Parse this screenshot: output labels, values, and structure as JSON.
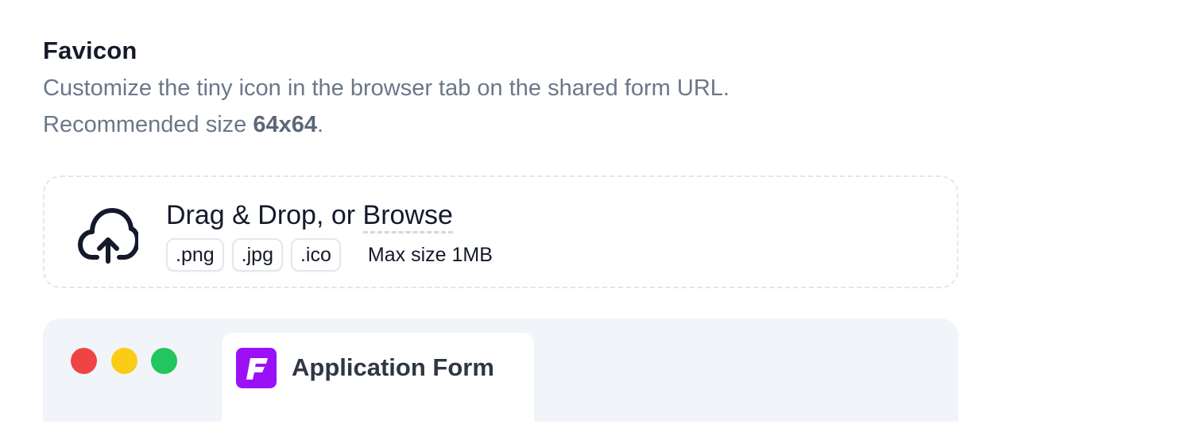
{
  "favicon_section": {
    "title": "Favicon",
    "description_line1": "Customize the tiny icon in the browser tab on the shared form URL.",
    "recommended_prefix": "Recommended size ",
    "recommended_size": "64x64",
    "recommended_suffix": "."
  },
  "dropzone": {
    "icon": "cloud-upload-icon",
    "main_text": "Drag & Drop, or ",
    "browse_label": "Browse",
    "formats": [
      ".png",
      ".jpg",
      ".ico"
    ],
    "max_size": "Max size 1MB"
  },
  "preview": {
    "window_controls": [
      "close",
      "minimize",
      "maximize"
    ],
    "tab_title": "Application Form",
    "favicon_icon": "brand-f-icon",
    "colors": {
      "close": "#ef4444",
      "minimize": "#facc15",
      "maximize": "#22c55e",
      "favicon_bg": "#9b11f5"
    }
  }
}
